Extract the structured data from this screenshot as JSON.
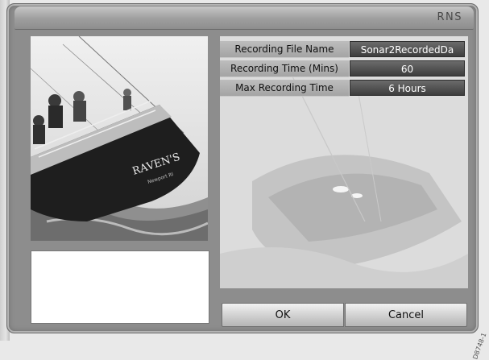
{
  "window": {
    "title": "RNS"
  },
  "photo": {
    "hull_name": "RAVEN'S",
    "hull_port": "Newport RI"
  },
  "settings": [
    {
      "label": "Recording File Name",
      "value": "Sonar2RecordedDa"
    },
    {
      "label": "Recording Time (Mins)",
      "value": "60"
    },
    {
      "label": "Max Recording Time",
      "value": "6 Hours"
    }
  ],
  "buttons": {
    "ok": "OK",
    "cancel": "Cancel"
  },
  "reference_code": "D8748-1"
}
